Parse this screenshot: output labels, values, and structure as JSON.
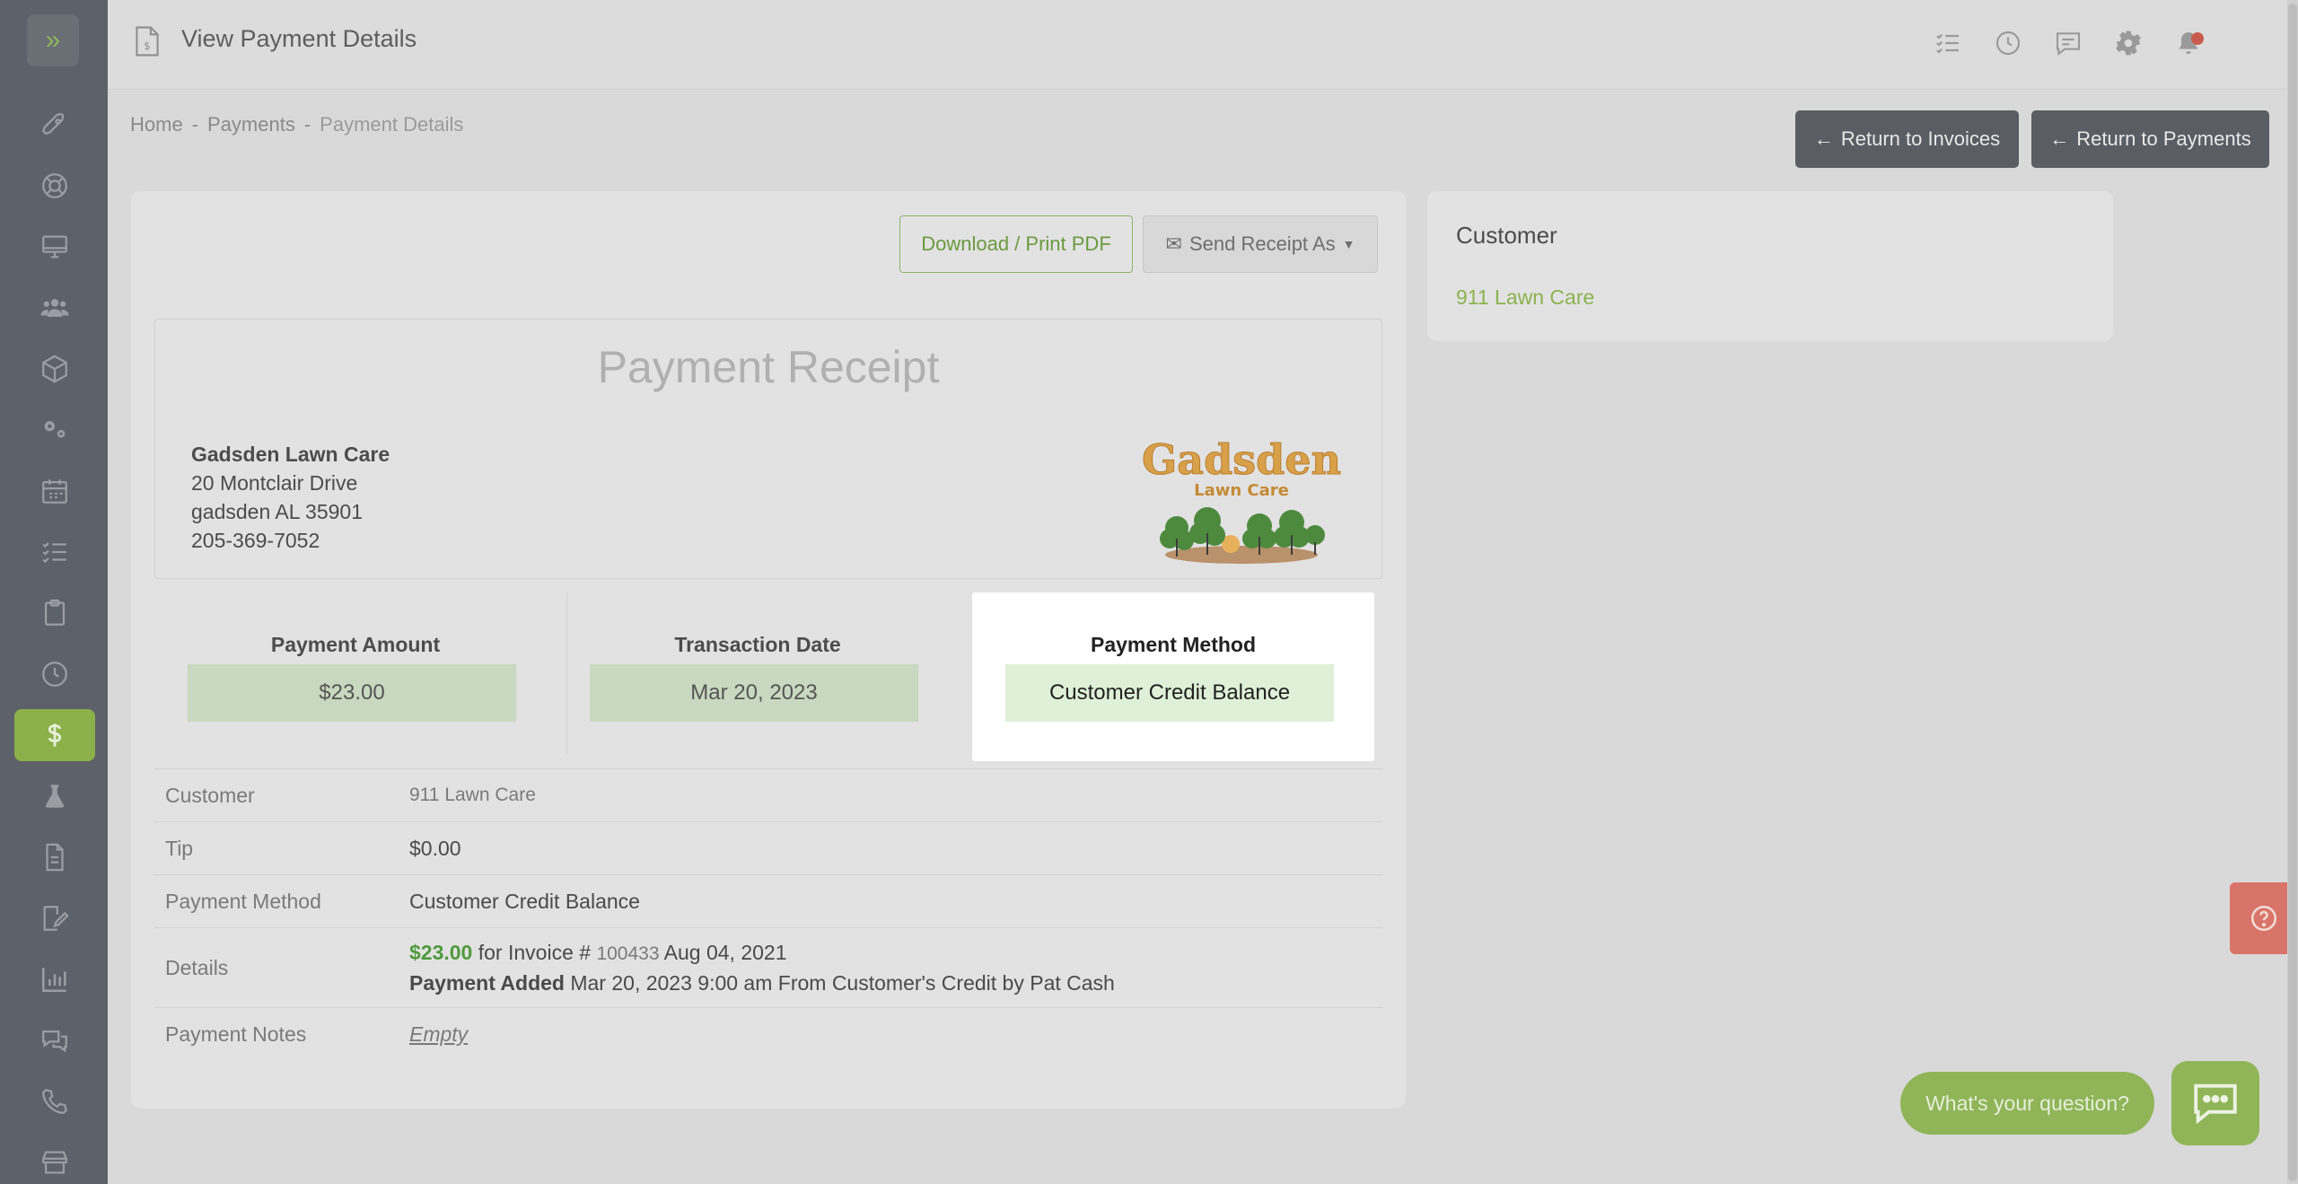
{
  "header": {
    "title": "View Payment Details"
  },
  "breadcrumb": {
    "home": "Home",
    "sep1": "-",
    "payments": "Payments",
    "sep2": "-",
    "current": "Payment Details"
  },
  "actions": {
    "return_invoices": "Return to Invoices",
    "return_payments": "Return to Payments",
    "download_pdf": "Download / Print PDF",
    "send_receipt": "Send Receipt As"
  },
  "receipt": {
    "title": "Payment Receipt",
    "company_name": "Gadsden Lawn Care",
    "address_line1": "20 Montclair Drive",
    "address_line2": "gadsden AL 35901",
    "phone": "205-369-7052",
    "logo_text_main": "Gadsden",
    "logo_text_sub": "Lawn Care"
  },
  "summary": [
    {
      "label": "Payment Amount",
      "value": "$23.00"
    },
    {
      "label": "Transaction Date",
      "value": "Mar 20, 2023"
    },
    {
      "label": "Payment Method",
      "value": "Customer Credit Balance"
    }
  ],
  "details": {
    "customer_label": "Customer",
    "customer_value": "911 Lawn Care",
    "tip_label": "Tip",
    "tip_value": "$0.00",
    "method_label": "Payment Method",
    "method_value": "Customer Credit Balance",
    "details_label": "Details",
    "details_amount": "$23.00",
    "details_for": "for Invoice #",
    "details_invoice": "100433",
    "details_invoice_date": "Aug 04, 2021",
    "details_added_label": "Payment Added",
    "details_added_text": "Mar 20, 2023 9:00 am From Customer's Credit by Pat Cash",
    "notes_label": "Payment Notes",
    "notes_value": "Empty"
  },
  "customer_card": {
    "title": "Customer",
    "name": "911 Lawn Care"
  },
  "support": {
    "question_prompt": "What's your question?"
  },
  "colors": {
    "brand_green": "#8cb04a",
    "sidebar_bg": "#5d6169",
    "highlight_bg": "#ffffff",
    "help_red": "#d9746a"
  }
}
